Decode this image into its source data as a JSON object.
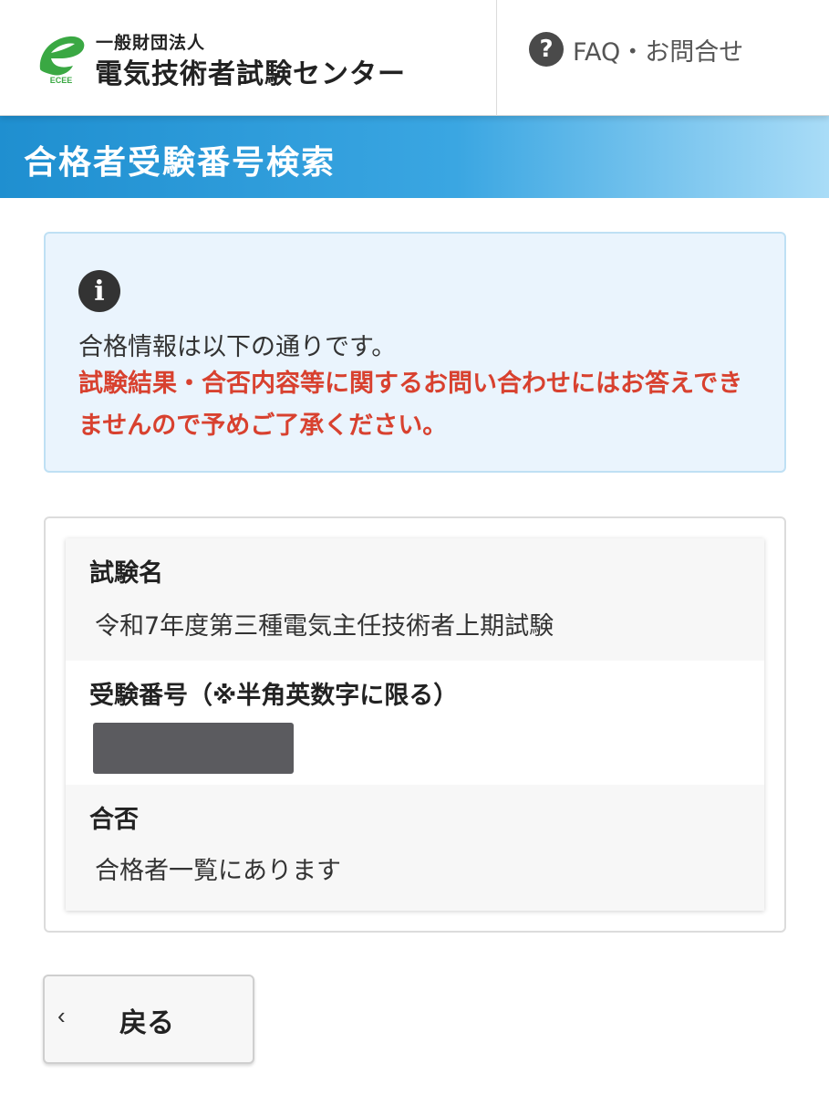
{
  "header": {
    "logo_small_text": "ECEE",
    "logo_sub": "一般財団法人",
    "logo_main": "電気技術者試験センター",
    "faq_icon_glyph": "?",
    "faq_label": "FAQ・お問合せ",
    "colors": {
      "logo_green": "#3aa843",
      "faq_icon": "#4a4a4a"
    }
  },
  "page": {
    "title": "合格者受験番号検索",
    "title_band_colors": [
      "#1f8fd0",
      "#a9dcf7"
    ]
  },
  "info": {
    "icon_glyph": "i",
    "message": "合格情報は以下の通りです。",
    "warning": "試験結果・合否内容等に関するお問い合わせにはお答えできませんので予めご了承ください。",
    "warning_color": "#d8412f"
  },
  "result": {
    "exam_name_label": "試験名",
    "exam_name_value": "令和7年度第三種電気主任技術者上期試験",
    "exam_number_label": "受験番号（※半角英数字に限る）",
    "result_label": "合否",
    "result_value": "合格者一覧にあります"
  },
  "back": {
    "chevron_glyph": "‹",
    "label": "戻る"
  }
}
